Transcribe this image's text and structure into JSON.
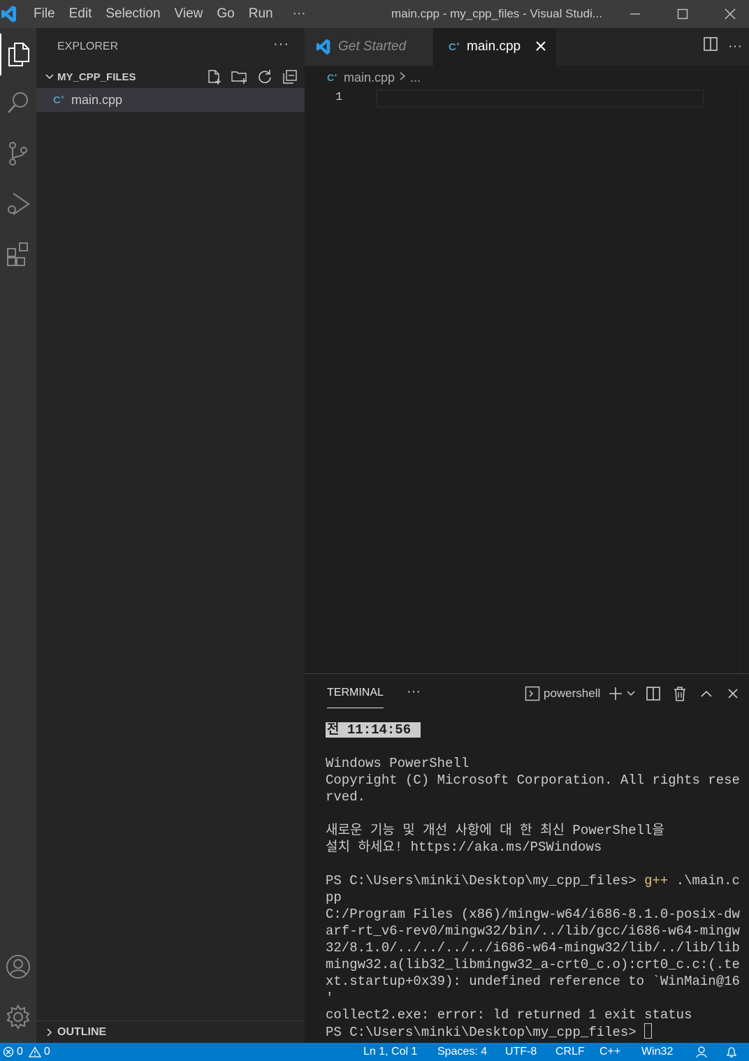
{
  "titlebar": {
    "menu": [
      "File",
      "Edit",
      "Selection",
      "View",
      "Go",
      "Run",
      "···"
    ],
    "title": "main.cpp - my_cpp_files - Visual Studi..."
  },
  "sidebar": {
    "header": "EXPLORER",
    "more": "···",
    "folder": "MY_CPP_FILES",
    "files": [
      {
        "name": "main.cpp",
        "icon": "cpp-file-icon"
      }
    ],
    "outline": "OUTLINE"
  },
  "tabs": [
    {
      "label": "Get Started",
      "active": false
    },
    {
      "label": "main.cpp",
      "active": true
    }
  ],
  "breadcrumb": {
    "file": "main.cpp",
    "tail": "..."
  },
  "editor": {
    "line_numbers": [
      "1"
    ]
  },
  "terminal": {
    "tab": "TERMINAL",
    "more": "···",
    "shell": "powershell",
    "time_prefix": "전",
    "time": "11:14:56",
    "lines": [
      "Windows PowerShell",
      "Copyright (C) Microsoft Corporation. All rights rese",
      "rved.",
      "",
      "새로운 기능 및 개선 사항에 대 한 최신 PowerShell을",
      "설치 하세요! https://aka.ms/PSWindows",
      ""
    ],
    "prompt": "PS C:\\Users\\minki\\Desktop\\my_cpp_files> ",
    "command_name": "g++",
    "command_args": " .\\main.c",
    "command_wrap": "pp",
    "output": [
      "C:/Program Files (x86)/mingw-w64/i686-8.1.0-posix-dw",
      "arf-rt_v6-rev0/mingw32/bin/../lib/gcc/i686-w64-mingw",
      "32/8.1.0/../../../../i686-w64-mingw32/lib/../lib/lib",
      "mingw32.a(lib32_libmingw32_a-crt0_c.o):crt0_c.c:(.te",
      "xt.startup+0x39): undefined reference to `WinMain@16",
      "'",
      "collect2.exe: error: ld returned 1 exit status"
    ],
    "final_prompt": "PS C:\\Users\\minki\\Desktop\\my_cpp_files> "
  },
  "statusbar": {
    "errors": "0",
    "warnings": "0",
    "position": "Ln 1, Col 1",
    "spaces": "Spaces: 4",
    "encoding": "UTF-8",
    "eol": "CRLF",
    "language": "C++",
    "platform": "Win32"
  },
  "colors": {
    "titlebar": "#3c3c3c",
    "activitybar": "#333333",
    "sidebar": "#252526",
    "editor": "#1e1e1e",
    "statusbar": "#007acc",
    "cpp_icon": "#519aba",
    "vscode_blue": "#2b9ae8"
  }
}
